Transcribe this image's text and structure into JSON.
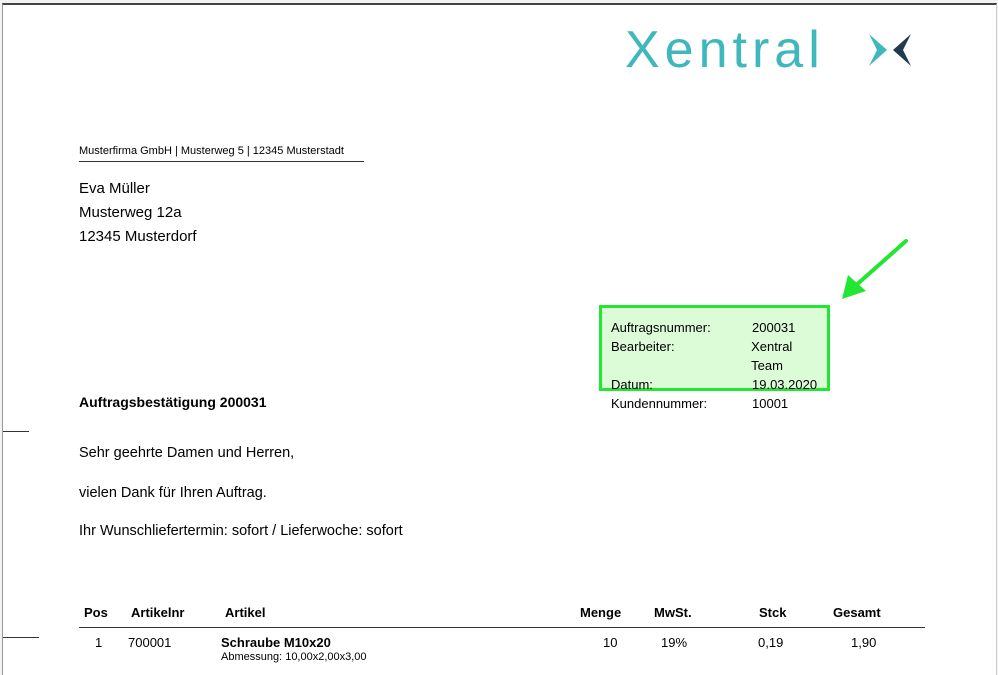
{
  "logo": {
    "text": "Xentral"
  },
  "sender_line": "Musterfirma GmbH | Musterweg 5 | 12345 Musterstadt",
  "recipient": {
    "name": "Eva Müller",
    "street": "Musterweg 12a",
    "city": "12345 Musterdorf"
  },
  "info": [
    {
      "label": "Auftragsnummer:",
      "value": "200031"
    },
    {
      "label": "Bearbeiter:",
      "value": "Xentral Team"
    },
    {
      "label": "Datum:",
      "value": "19.03.2020"
    },
    {
      "label": "Kundennummer:",
      "value": "10001"
    }
  ],
  "title": "Auftragsbestätigung 200031",
  "greeting": "Sehr geehrte Damen und Herren,",
  "thanks": "vielen Dank für Ihren Auftrag.",
  "delivery": "Ihr Wunschliefertermin: sofort / Lieferwoche: sofort",
  "table": {
    "headers": {
      "pos": "Pos",
      "artikelnr": "Artikelnr",
      "artikel": "Artikel",
      "menge": "Menge",
      "mwst": "MwSt.",
      "stck": "Stck",
      "gesamt": "Gesamt"
    },
    "rows": [
      {
        "pos": "1",
        "artikelnr": "700001",
        "artikel": "Schraube M10x20",
        "detail": "Abmessung: 10,00x2,00x3,00",
        "menge": "10",
        "mwst": "19%",
        "stck": "0,19",
        "gesamt": "1,90"
      }
    ]
  },
  "colors": {
    "logo": "#3fb8bd",
    "highlight_border": "#22e632",
    "highlight_fill": "#dcfcd8",
    "arrow": "#22e632"
  }
}
